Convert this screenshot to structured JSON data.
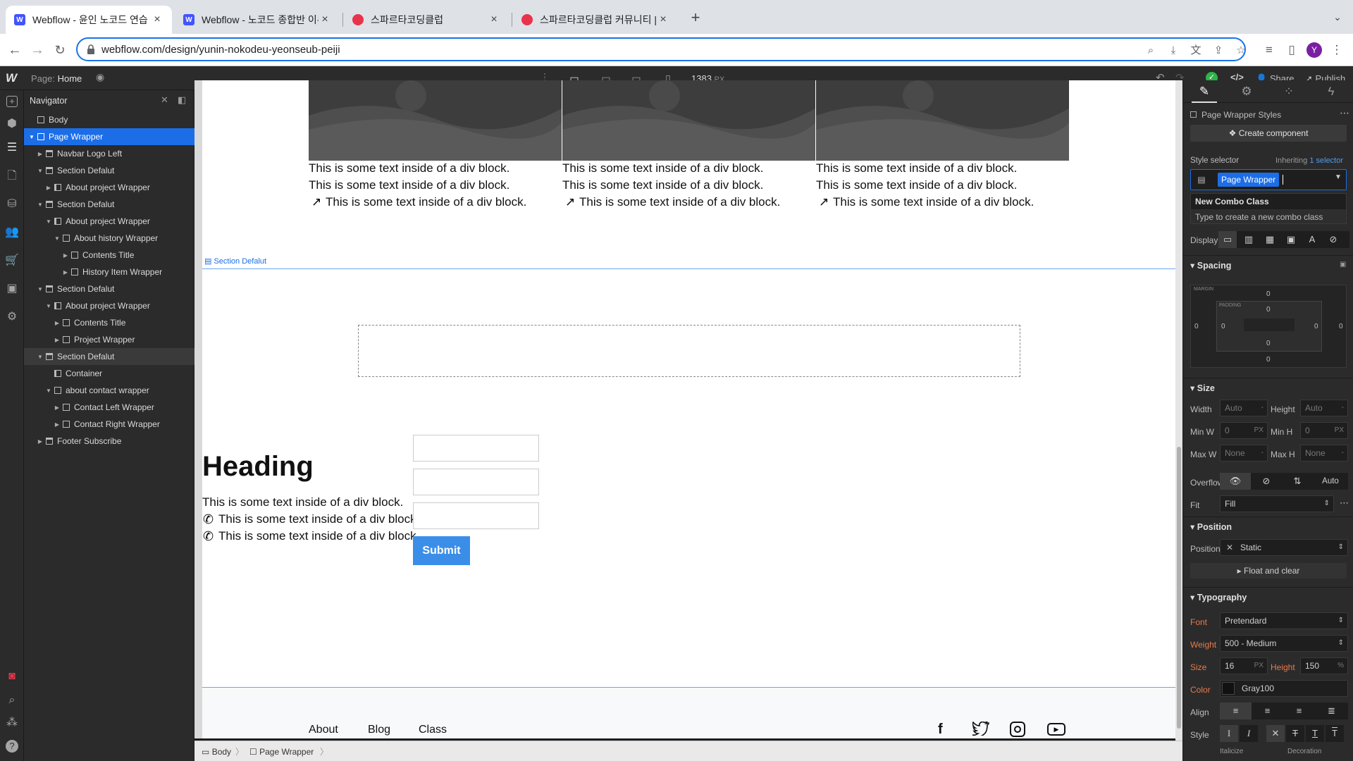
{
  "browser": {
    "tabs": [
      {
        "title": "Webflow - 윤인 노코드 연습 페이지",
        "favicon": "webflow-favicon-icon"
      },
      {
        "title": "Webflow - 노코드 종합반 이론 안내",
        "favicon": "webflow-favicon-icon"
      },
      {
        "title": "스파르타코딩클럽",
        "favicon": "sparta-favicon-icon"
      },
      {
        "title": "스파르타코딩클럽 커뮤니티 | 스파르",
        "favicon": "sparta-favicon-icon"
      }
    ],
    "url": "webflow.com/design/yunin-nokodeu-yeonseub-peiji",
    "profile_initial": "Y"
  },
  "topbar": {
    "page_label": "Page:",
    "page_name": "Home",
    "width_value": "1383",
    "width_unit": "PX",
    "share_label": "Share",
    "publish_label": "Publish"
  },
  "navigator": {
    "title": "Navigator",
    "items": [
      {
        "label": "Body",
        "depth": 0,
        "caret": "",
        "kind": "box",
        "state": ""
      },
      {
        "label": "Page Wrapper",
        "depth": 0,
        "caret": "▼",
        "kind": "box",
        "state": "selected"
      },
      {
        "label": "Navbar Logo Left",
        "depth": 1,
        "caret": "▶",
        "kind": "sec",
        "state": ""
      },
      {
        "label": "Section Defalut",
        "depth": 1,
        "caret": "▼",
        "kind": "sec",
        "state": ""
      },
      {
        "label": "About project Wrapper",
        "depth": 2,
        "caret": "▶",
        "kind": "col",
        "state": ""
      },
      {
        "label": "Section Defalut",
        "depth": 1,
        "caret": "▼",
        "kind": "sec",
        "state": ""
      },
      {
        "label": "About project Wrapper",
        "depth": 2,
        "caret": "▼",
        "kind": "col",
        "state": ""
      },
      {
        "label": "About history Wrapper",
        "depth": 3,
        "caret": "▼",
        "kind": "box",
        "state": ""
      },
      {
        "label": "Contents Title",
        "depth": 4,
        "caret": "▶",
        "kind": "box",
        "state": ""
      },
      {
        "label": "History Item Wrapper",
        "depth": 4,
        "caret": "▶",
        "kind": "box",
        "state": ""
      },
      {
        "label": "Section Defalut",
        "depth": 1,
        "caret": "▼",
        "kind": "sec",
        "state": ""
      },
      {
        "label": "About project Wrapper",
        "depth": 2,
        "caret": "▼",
        "kind": "col",
        "state": ""
      },
      {
        "label": "Contents Title",
        "depth": 3,
        "caret": "▶",
        "kind": "box",
        "state": ""
      },
      {
        "label": "Project Wrapper",
        "depth": 3,
        "caret": "▶",
        "kind": "box",
        "state": ""
      },
      {
        "label": "Section Defalut",
        "depth": 1,
        "caret": "▼",
        "kind": "sec",
        "state": "hover"
      },
      {
        "label": "Container",
        "depth": 2,
        "caret": "",
        "kind": "col",
        "state": ""
      },
      {
        "label": "about contact wrapper",
        "depth": 2,
        "caret": "▼",
        "kind": "box",
        "state": ""
      },
      {
        "label": "Contact Left Wrapper",
        "depth": 3,
        "caret": "▶",
        "kind": "box",
        "state": ""
      },
      {
        "label": "Contact Right Wrapper",
        "depth": 3,
        "caret": "▶",
        "kind": "box",
        "state": ""
      },
      {
        "label": "Footer Subscribe",
        "depth": 1,
        "caret": "▶",
        "kind": "sec",
        "state": ""
      }
    ]
  },
  "canvas": {
    "text_line": "This is some text inside of a div block.",
    "section_label": "Section Defalut",
    "heading": "Heading",
    "submit_label": "Submit",
    "footer_links": [
      "About",
      "Blog",
      "Class"
    ]
  },
  "panel": {
    "styles_label": "Page Wrapper Styles",
    "create_component": "Create component",
    "style_selector_label": "Style selector",
    "inheriting_label": "Inheriting",
    "inheriting_count": "1 selector",
    "class_chip": "Page Wrapper",
    "combo_title": "New Combo Class",
    "combo_hint": "Type to create a new combo class",
    "display_label": "Display",
    "spacing": {
      "title": "Spacing",
      "margin_label": "MARGIN",
      "padding_label": "PADDING",
      "margin_top": "0",
      "margin_right": "0",
      "margin_bottom": "0",
      "margin_left": "0",
      "padding_top": "0",
      "padding_right": "0",
      "padding_bottom": "0",
      "padding_left": "0"
    },
    "size": {
      "title": "Size",
      "width_label": "Width",
      "width_value": "Auto",
      "width_unit": "-",
      "height_label": "Height",
      "height_value": "Auto",
      "height_unit": "-",
      "minw_label": "Min W",
      "minw_value": "0",
      "minw_unit": "PX",
      "minh_label": "Min H",
      "minh_value": "0",
      "minh_unit": "PX",
      "maxw_label": "Max W",
      "maxw_value": "None",
      "maxw_unit": "-",
      "maxh_label": "Max H",
      "maxh_value": "None",
      "maxh_unit": "-",
      "overflow_label": "Overflow",
      "overflow_auto": "Auto",
      "fit_label": "Fit",
      "fit_value": "Fill"
    },
    "position": {
      "title": "Position",
      "position_label": "Position",
      "position_value": "Static",
      "float_label": "Float and clear"
    },
    "typography": {
      "title": "Typography",
      "font_label": "Font",
      "font_value": "Pretendard",
      "weight_label": "Weight",
      "weight_value": "500 - Medium",
      "size_label": "Size",
      "size_value": "16",
      "size_unit": "PX",
      "height_label": "Height",
      "height_value": "150",
      "height_unit": "%",
      "color_label": "Color",
      "color_value": "Gray100",
      "align_label": "Align",
      "style_label": "Style",
      "italicize_label": "Italicize",
      "decoration_label": "Decoration"
    }
  },
  "breadcrumb": [
    "Body",
    "Page Wrapper"
  ],
  "colors": {
    "accent": "#1c6ee8",
    "label_orange": "#e8794a",
    "submit_blue": "#3b8ee8"
  }
}
